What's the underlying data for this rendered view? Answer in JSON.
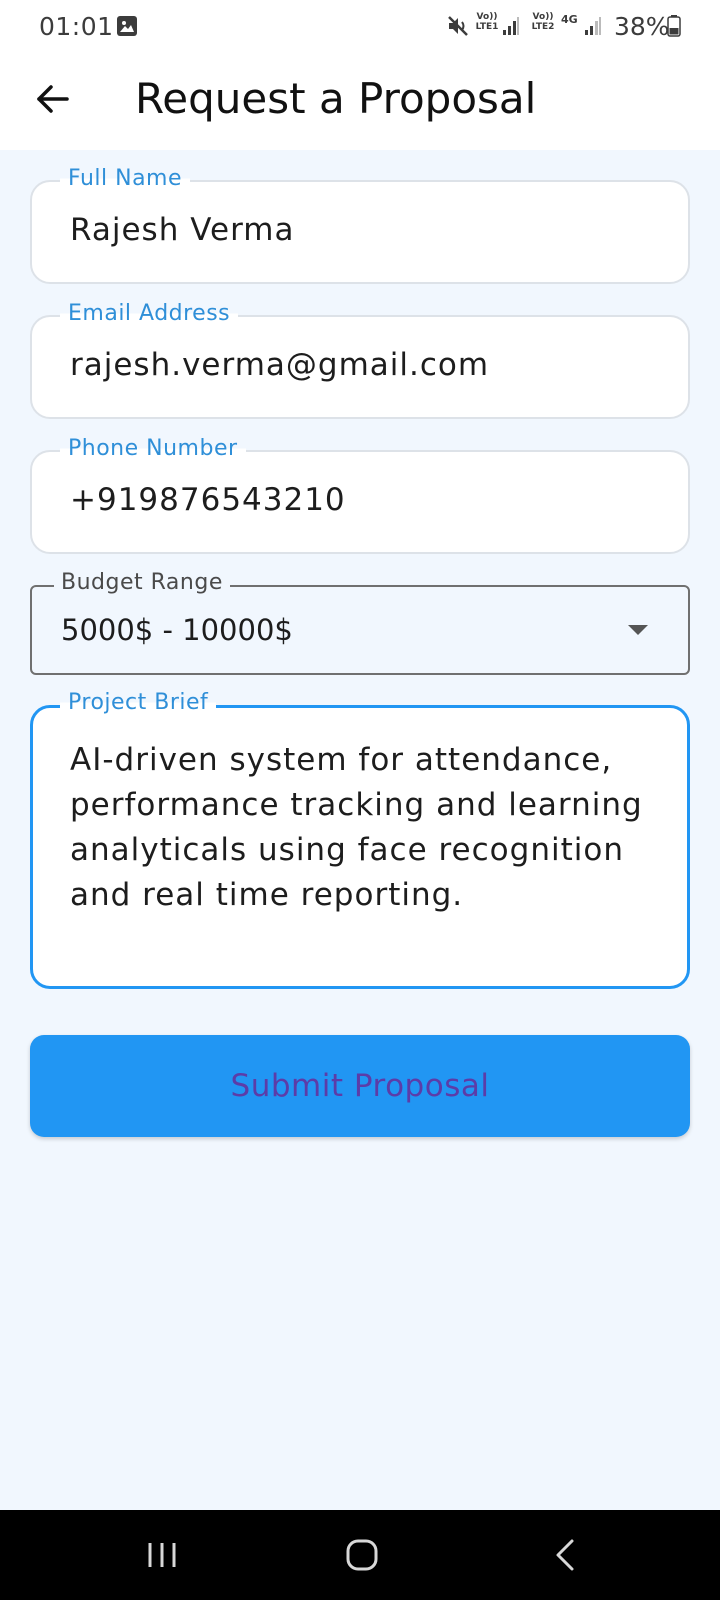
{
  "status_bar": {
    "time": "01:01",
    "sim1_label": "Vo)) LTE1",
    "sim2_label": "Vo)) LTE2",
    "sim2_network": "4G",
    "battery": "38%",
    "icons": [
      "gallery-icon",
      "mute-icon",
      "signal-icon",
      "battery-icon"
    ]
  },
  "app_bar": {
    "title": "Request a Proposal",
    "back_icon": "arrow-left-icon"
  },
  "form": {
    "full_name": {
      "label": "Full Name",
      "value": "Rajesh Verma"
    },
    "email": {
      "label": "Email Address",
      "value": "rajesh.verma@gmail.com"
    },
    "phone": {
      "label": "Phone Number",
      "value": "+919876543210"
    },
    "budget": {
      "label": "Budget Range",
      "value": "5000$ - 10000$"
    },
    "brief": {
      "label": "Project Brief",
      "value": "AI-driven system for attendance,\nperformance tracking and learning\nanalyticals using face recognition\nand real time reporting."
    },
    "submit_label": "Submit Proposal"
  },
  "colors": {
    "accent": "#2196f3",
    "label_blue": "#2f8fd8",
    "submit_text": "#5c3ca8",
    "background": "#f1f7fe"
  },
  "nav_bar": {
    "icons": [
      "recent-apps-icon",
      "home-icon",
      "back-icon"
    ]
  }
}
